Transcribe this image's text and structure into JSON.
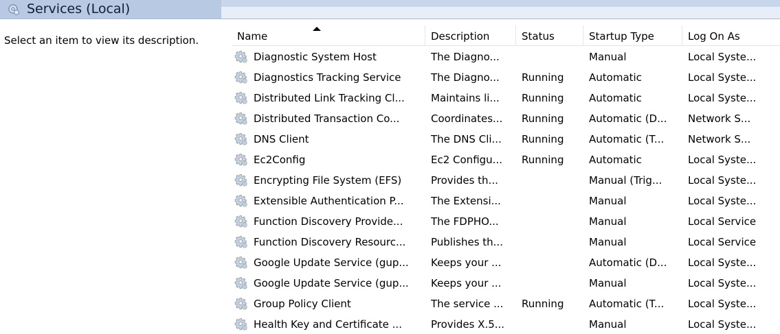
{
  "window": {
    "title": "Services (Local)"
  },
  "description_pane": {
    "text": "Select an item to view its description."
  },
  "columns": [
    "Name",
    "Description",
    "Status",
    "Startup Type",
    "Log On As"
  ],
  "rows": [
    {
      "name": "Diagnostic System Host",
      "description": "The Diagno...",
      "status": "",
      "startup": "Manual",
      "logon": "Local Syste..."
    },
    {
      "name": "Diagnostics Tracking Service",
      "description": "The Diagno...",
      "status": "Running",
      "startup": "Automatic",
      "logon": "Local Syste..."
    },
    {
      "name": "Distributed Link Tracking Cl...",
      "description": "Maintains li...",
      "status": "Running",
      "startup": "Automatic",
      "logon": "Local Syste..."
    },
    {
      "name": "Distributed Transaction Co...",
      "description": "Coordinates...",
      "status": "Running",
      "startup": "Automatic (D...",
      "logon": "Network S..."
    },
    {
      "name": "DNS Client",
      "description": "The DNS Cli...",
      "status": "Running",
      "startup": "Automatic (T...",
      "logon": "Network S..."
    },
    {
      "name": "Ec2Config",
      "description": "Ec2 Configu...",
      "status": "Running",
      "startup": "Automatic",
      "logon": "Local Syste..."
    },
    {
      "name": "Encrypting File System (EFS)",
      "description": "Provides th...",
      "status": "",
      "startup": "Manual (Trig...",
      "logon": "Local Syste..."
    },
    {
      "name": "Extensible Authentication P...",
      "description": "The Extensi...",
      "status": "",
      "startup": "Manual",
      "logon": "Local Syste..."
    },
    {
      "name": "Function Discovery Provide...",
      "description": "The FDPHO...",
      "status": "",
      "startup": "Manual",
      "logon": "Local Service"
    },
    {
      "name": "Function Discovery Resourc...",
      "description": "Publishes th...",
      "status": "",
      "startup": "Manual",
      "logon": "Local Service"
    },
    {
      "name": "Google Update Service (gup...",
      "description": "Keeps your ...",
      "status": "",
      "startup": "Automatic (D...",
      "logon": "Local Syste..."
    },
    {
      "name": "Google Update Service (gup...",
      "description": "Keeps your ...",
      "status": "",
      "startup": "Manual",
      "logon": "Local Syste..."
    },
    {
      "name": "Group Policy Client",
      "description": "The service ...",
      "status": "Running",
      "startup": "Automatic (T...",
      "logon": "Local Syste..."
    },
    {
      "name": "Health Key and Certificate ...",
      "description": "Provides X.5...",
      "status": "",
      "startup": "Manual",
      "logon": "Local Syste..."
    }
  ],
  "icons": {
    "title": "services-icon",
    "row": "service-gear-icon"
  }
}
